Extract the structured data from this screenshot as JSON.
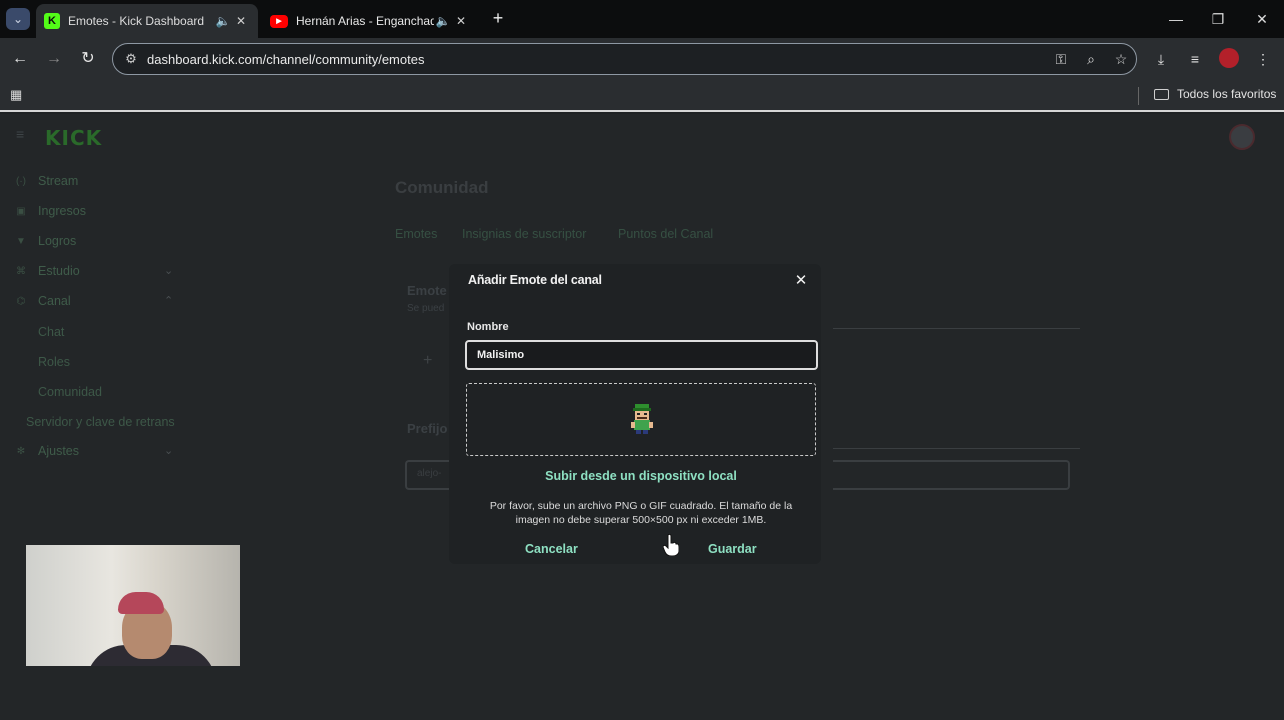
{
  "browser": {
    "tabs": [
      {
        "title": "Emotes - Kick Dashboard",
        "favicon": "kick-favicon",
        "active": true
      },
      {
        "title": "Hernán Arias - Enganchado",
        "favicon": "youtube-favicon",
        "active": false
      }
    ],
    "url": "dashboard.kick.com/channel/community/emotes",
    "bookmarks_folder": "Todos los favoritos"
  },
  "sidebar": {
    "logo": "KICK",
    "items": [
      {
        "label": "Stream",
        "icon": "stream-icon"
      },
      {
        "label": "Ingresos",
        "icon": "revenue-icon"
      },
      {
        "label": "Logros",
        "icon": "trophy-icon"
      },
      {
        "label": "Estudio",
        "icon": "studio-icon"
      },
      {
        "label": "Canal",
        "icon": "channel-icon"
      },
      {
        "label": "Chat"
      },
      {
        "label": "Roles"
      },
      {
        "label": "Comunidad"
      },
      {
        "label": "Servidor y clave de retrans"
      },
      {
        "label": "Ajustes",
        "icon": "gear-icon"
      }
    ]
  },
  "background": {
    "page_title": "Comunidad",
    "tabs": [
      "Emotes",
      "Insignias de suscriptor",
      "Puntos del Canal"
    ],
    "card_title": "Emote",
    "card_sub": "Se pued",
    "prefix_label": "Prefijo",
    "prefix_value": "alejo-"
  },
  "modal": {
    "title": "Añadir Emote del canal",
    "name_label": "Nombre",
    "name_value": "Malisimo",
    "upload_link": "Subir desde un dispositivo local",
    "help_text": "Por favor, sube un archivo PNG o GIF cuadrado. El tamaño de la imagen no debe superar 500×500 px ni exceder 1MB.",
    "cancel": "Cancelar",
    "save": "Guardar"
  },
  "colors": {
    "accent": "#8ee0c2",
    "kick_green": "#53fc18",
    "modal_bg": "#1f2224"
  }
}
